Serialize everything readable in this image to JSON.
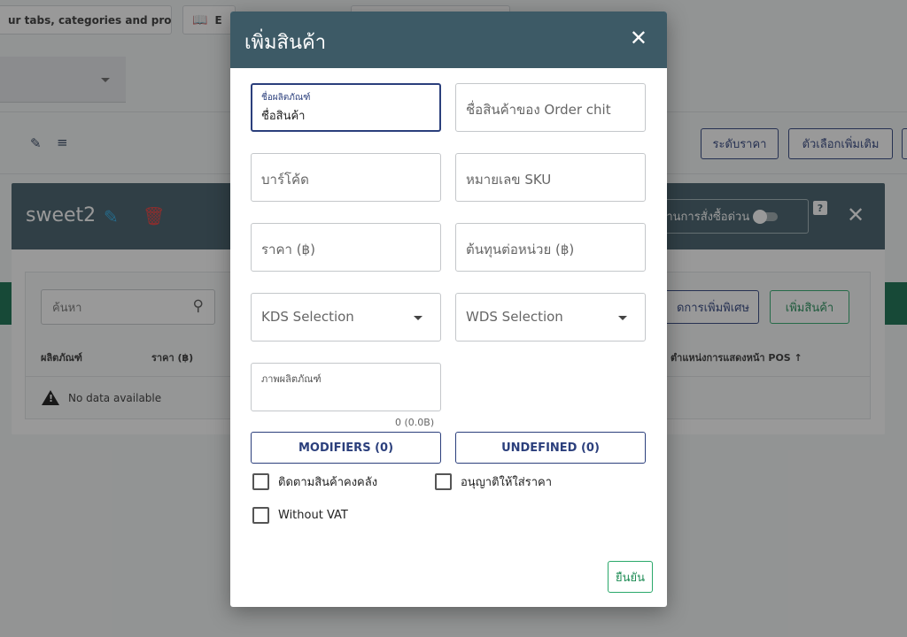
{
  "background": {
    "topbar": {
      "tab_hint": "ur tabs, categories and products",
      "book_label": "E"
    },
    "toolbar": {
      "price_level_label": "ระดับราคา",
      "more_options_label": "ตัวเลือกเพิ่มเติม"
    },
    "category": {
      "name": "sweet2",
      "quick_order_label": "งานการสั่งซื้อด่วน",
      "help_label": "?",
      "search_placeholder": "ค้นหา",
      "special_add_label": "ดการเพิ่มพิเศษ",
      "add_product_label": "เพิ่มสินค้า",
      "columns": [
        "ผลิตภัณฑ์",
        "ราคา (฿)",
        "ตำแหน่งการแสดงหน้า POS ↑"
      ],
      "empty_text": "No data available"
    }
  },
  "dialog": {
    "title": "เพิ่มสินค้า",
    "fields": {
      "product_name": {
        "label": "ชื่อผลิตภัณฑ์",
        "value": "ชื่อสินค้า"
      },
      "order_chit_name": {
        "placeholder": "ชื่อสินค้าของ Order chit"
      },
      "barcode": {
        "placeholder": "บาร์โค้ด"
      },
      "sku": {
        "placeholder": "หมายเลข SKU"
      },
      "price": {
        "placeholder": "ราคา (฿)"
      },
      "unit_cost": {
        "placeholder": "ต้นทุนต่อหน่วย (฿)"
      },
      "kds": {
        "placeholder": "KDS Selection"
      },
      "wds": {
        "placeholder": "WDS Selection"
      },
      "image": {
        "label": "ภาพผลิตภัณฑ์",
        "counter": "0 (0.0B)"
      }
    },
    "modifiers_label": "MODIFIERS (0)",
    "undefined_label": "UNDEFINED (0)",
    "checkboxes": {
      "track_stock": "ติดตามสินค้าคงคลัง",
      "allow_price": "อนุญาติให้ใส่ราคา",
      "without_vat": "Without VAT"
    },
    "confirm_label": "ยืนยัน"
  }
}
